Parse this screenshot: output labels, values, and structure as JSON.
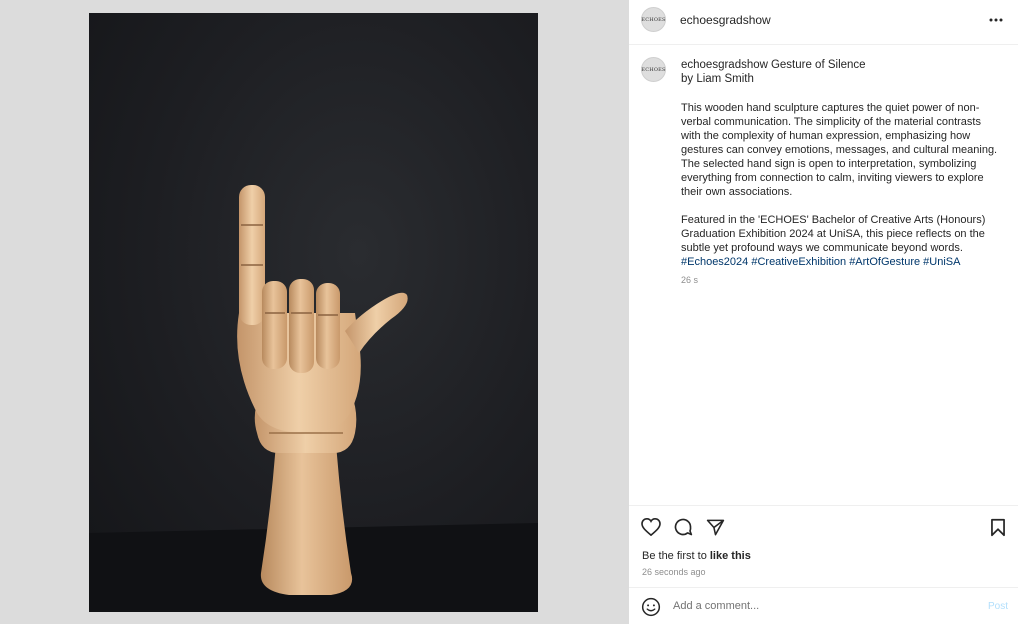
{
  "account": {
    "username": "echoesgradshow",
    "avatar_text": "ECHOES"
  },
  "caption": {
    "username": "echoesgradshow",
    "title_line1": "Gesture of Silence",
    "title_line2": "by Liam Smith",
    "paragraph1": "This wooden hand sculpture captures the quiet power of non-verbal communication. The simplicity of the material contrasts with the complexity of human expression, emphasizing how gestures can convey emotions, messages, and cultural meaning. The selected hand sign is open to interpretation, symbolizing everything from connection to calm, inviting viewers to explore their own associations.",
    "paragraph2": "Featured in the 'ECHOES' Bachelor of Creative Arts (Honours) Graduation Exhibition 2024 at UniSA, this piece reflects on the subtle yet profound ways we communicate beyond words.",
    "hashtags": [
      "#Echoes2024",
      "#CreativeExhibition",
      "#ArtOfGesture",
      "#UniSA"
    ],
    "time": "26 s"
  },
  "actions": {
    "like_icon": "heart-icon",
    "comment_icon": "comment-icon",
    "share_icon": "send-icon",
    "save_icon": "bookmark-icon",
    "likes_prefix": "Be the first to",
    "likes_link": "like this",
    "posted_ago": "26 seconds ago"
  },
  "comment": {
    "placeholder": "Add a comment...",
    "post_label": "Post",
    "emoji_icon": "smiley-icon"
  },
  "colors": {
    "media_background": "#dcdcdc",
    "hashtag": "#00376b",
    "post_button_disabled": "#b2dffc",
    "muted_text": "#8e8e8e"
  }
}
